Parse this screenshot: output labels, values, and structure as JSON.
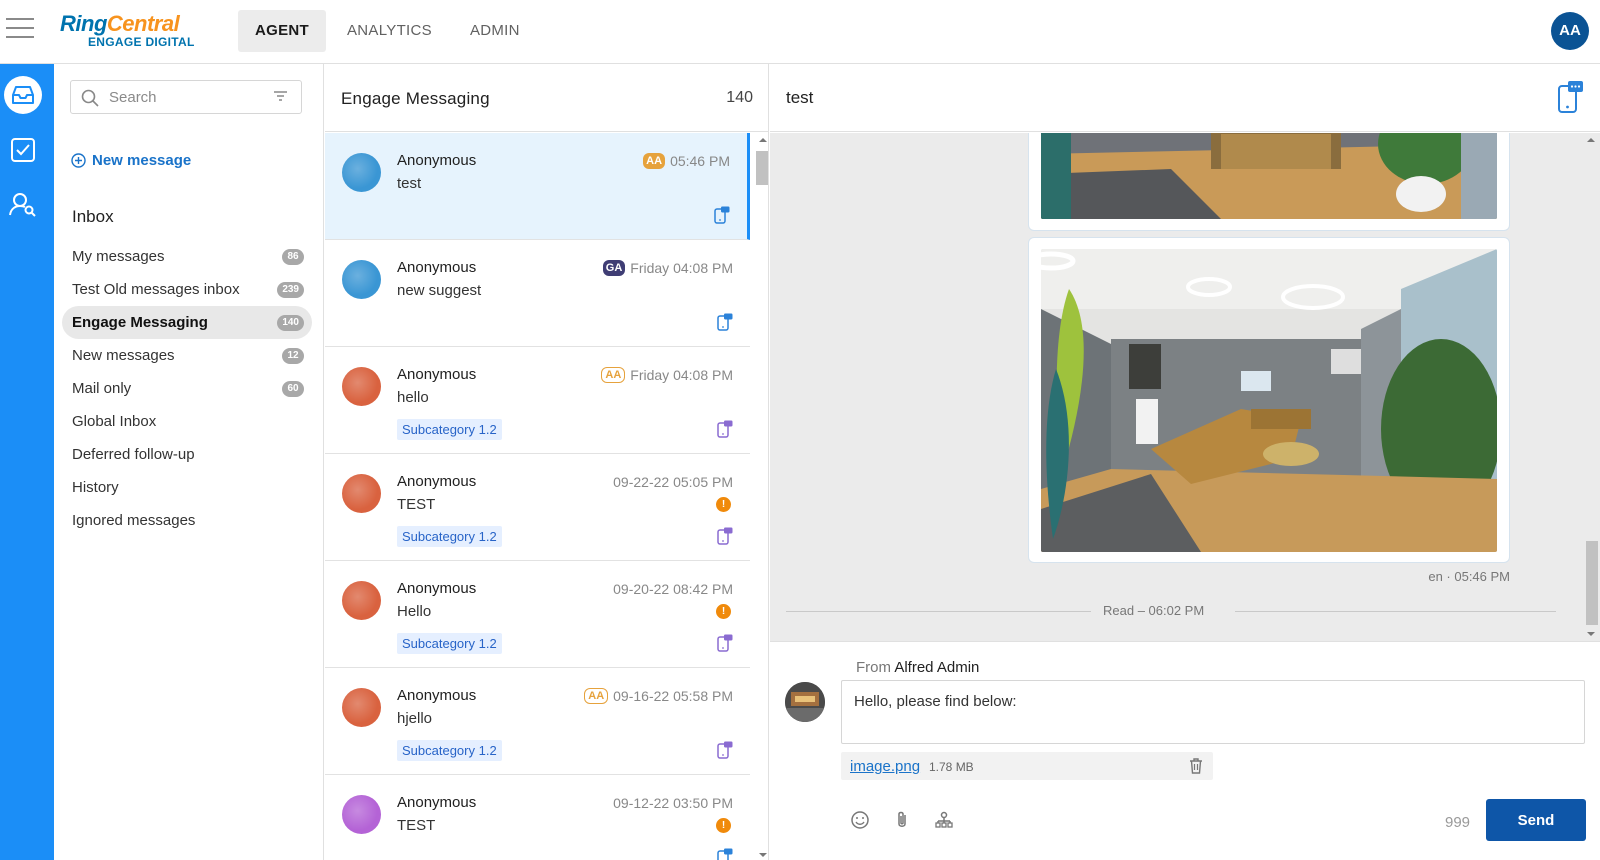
{
  "header": {
    "logo_main_a": "Ring",
    "logo_main_b": "Central",
    "logo_sub": "ENGAGE DIGITAL",
    "nav": [
      {
        "label": "AGENT",
        "active": true
      },
      {
        "label": "ANALYTICS",
        "active": false
      },
      {
        "label": "ADMIN",
        "active": false
      }
    ],
    "user_initials": "AA"
  },
  "rail": {
    "icons": [
      "inbox-icon",
      "task-check-icon",
      "contacts-icon"
    ]
  },
  "sidebar": {
    "search_placeholder": "Search",
    "new_message_label": "New message",
    "inbox_title": "Inbox",
    "items": [
      {
        "label": "My messages",
        "count": "86",
        "active": false
      },
      {
        "label": "Test Old messages inbox",
        "count": "239",
        "active": false
      },
      {
        "label": "Engage Messaging",
        "count": "140",
        "active": true
      },
      {
        "label": "New messages",
        "count": "12",
        "active": false
      },
      {
        "label": "Mail only",
        "count": "60",
        "active": false
      },
      {
        "label": "Global Inbox",
        "count": "",
        "active": false
      },
      {
        "label": "Deferred follow-up",
        "count": "",
        "active": false
      },
      {
        "label": "History",
        "count": "",
        "active": false
      },
      {
        "label": "Ignored messages",
        "count": "",
        "active": false
      }
    ]
  },
  "conversations": {
    "title": "Engage Messaging",
    "count": "140",
    "items": [
      {
        "name": "Anonymous",
        "preview": "test",
        "badge": "AA",
        "badge_style": "filled-orange",
        "time": "05:46 PM",
        "subcategory": "",
        "warning": false,
        "avatar_color": "#3a96d4",
        "selected": true
      },
      {
        "name": "Anonymous",
        "preview": "new suggest",
        "badge": "GA",
        "badge_style": "filled-navy",
        "time": "Friday 04:08 PM",
        "subcategory": "",
        "warning": false,
        "avatar_color": "#3a96d4",
        "selected": false
      },
      {
        "name": "Anonymous",
        "preview": "hello",
        "badge": "AA",
        "badge_style": "outline-orange",
        "time": "Friday 04:08 PM",
        "subcategory": "Subcategory 1.2",
        "warning": false,
        "avatar_color": "#d9623f",
        "selected": false
      },
      {
        "name": "Anonymous",
        "preview": "TEST",
        "badge": "",
        "badge_style": "",
        "time": "09-22-22 05:05 PM",
        "subcategory": "Subcategory 1.2",
        "warning": true,
        "warning_symbol": "!",
        "avatar_color": "#d9623f",
        "selected": false
      },
      {
        "name": "Anonymous",
        "preview": "Hello",
        "badge": "",
        "badge_style": "",
        "time": "09-20-22 08:42 PM",
        "subcategory": "Subcategory 1.2",
        "warning": true,
        "warning_symbol": "!",
        "avatar_color": "#d9623f",
        "selected": false
      },
      {
        "name": "Anonymous",
        "preview": "hjello",
        "badge": "AA",
        "badge_style": "outline-orange",
        "time": "09-16-22 05:58 PM",
        "subcategory": "Subcategory 1.2",
        "warning": false,
        "avatar_color": "#d9623f",
        "selected": false
      },
      {
        "name": "Anonymous",
        "preview": "TEST",
        "badge": "",
        "badge_style": "",
        "time": "09-12-22 03:50 PM",
        "subcategory": "",
        "warning": true,
        "warning_symbol": "!",
        "avatar_color": "#b463d6",
        "selected": false
      }
    ]
  },
  "thread": {
    "title": "test",
    "message_meta": "en · 05:46 PM",
    "read_status": "Read – 06:02 PM"
  },
  "compose": {
    "from_label": "From",
    "from_name": "Alfred Admin",
    "body_text": "Hello, please find below:",
    "attachment_name": "image.png",
    "attachment_size": "1.78 MB",
    "char_count": "999",
    "send_label": "Send"
  },
  "colors": {
    "accent": "#1b8ef7",
    "send": "#0e56a8",
    "badge_orange": "#e6a23c",
    "badge_navy": "#3f3d74",
    "warning": "#f08a0b"
  }
}
